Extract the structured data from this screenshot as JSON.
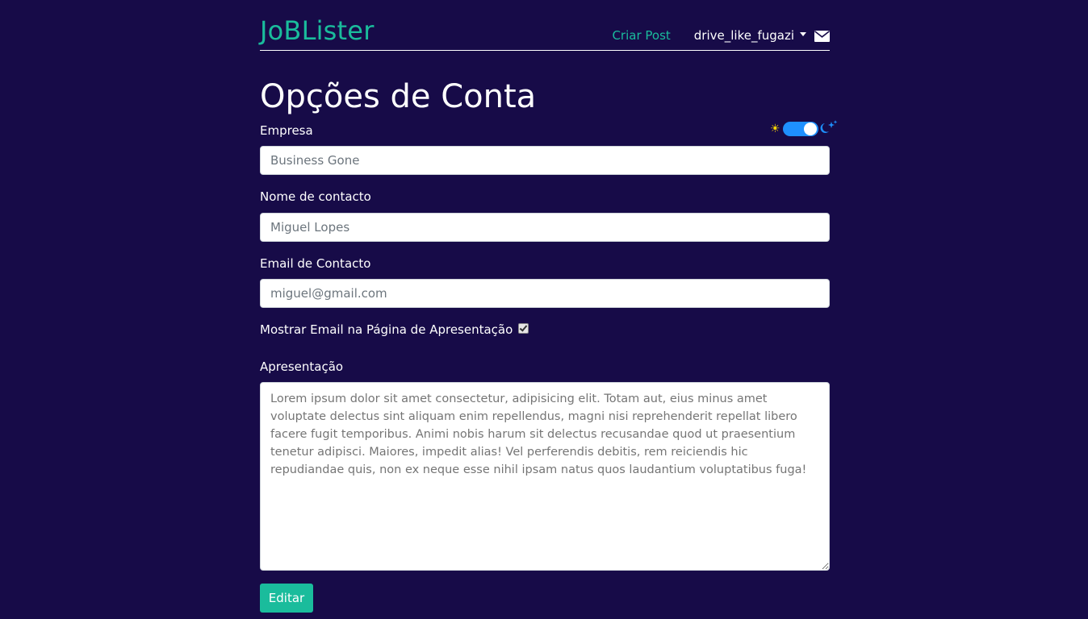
{
  "navbar": {
    "brand": "JoBLister",
    "create_post_label": "Criar Post",
    "username": "drive_like_fugazi",
    "mail_icon": "envelope-icon"
  },
  "page": {
    "title": "Opções de Conta"
  },
  "theme_toggle": {
    "light_icon": "☀",
    "dark_icon": "⏾",
    "state": "dark"
  },
  "form": {
    "company": {
      "label": "Empresa",
      "placeholder": "Business Gone"
    },
    "contact_name": {
      "label": "Nome de contacto",
      "placeholder": "Miguel Lopes"
    },
    "contact_email": {
      "label": "Email de Contacto",
      "placeholder": "miguel@gmail.com"
    },
    "show_email": {
      "label": "Mostrar Email na Página de Apresentação",
      "checked": true
    },
    "presentation": {
      "label": "Apresentação",
      "placeholder": "Lorem ipsum dolor sit amet consectetur, adipisicing elit. Totam aut, eius minus amet voluptate delectus sint aliquam enim repellendus, magni nisi reprehenderit repellat libero facere fugit temporibus. Animi nobis harum sit delectus recusandae quod ut praesentium tenetur adipisci. Maiores, impedit alias! Vel perferendis debitis, rem reiciendis hic repudiandae quis, non ex neque esse nihil ipsam natus quos laudantium voluptatibus fuga!"
    },
    "submit_label": "Editar"
  },
  "colors": {
    "background": "#170b48",
    "accent": "#1abc9c",
    "toggle": "#1e90ff"
  }
}
